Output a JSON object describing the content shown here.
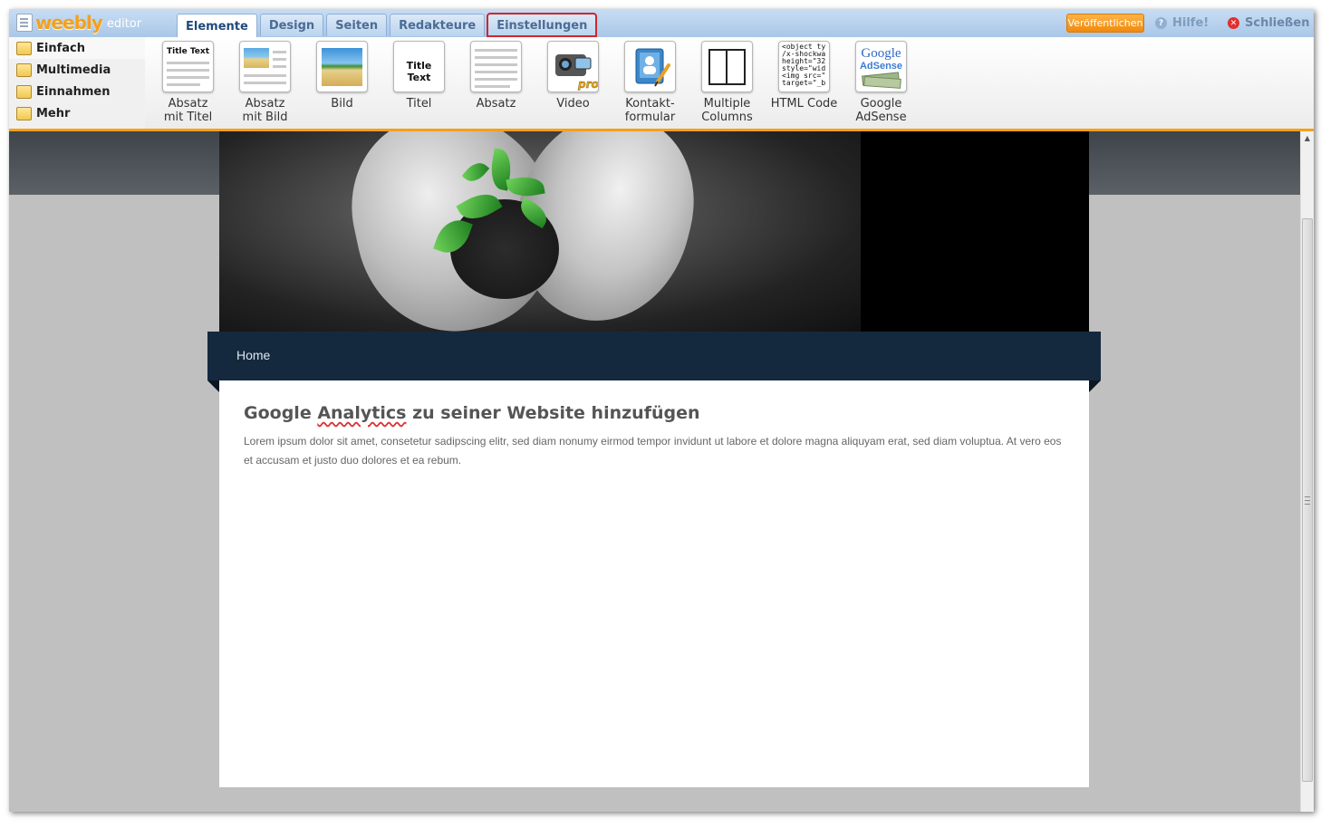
{
  "app": {
    "brand": "weebly",
    "subtitle": "editor"
  },
  "tabs": [
    {
      "label": "Elemente",
      "active": true
    },
    {
      "label": "Design"
    },
    {
      "label": "Seiten"
    },
    {
      "label": "Redakteure"
    },
    {
      "label": "Einstellungen",
      "highlighted": true
    }
  ],
  "actions": {
    "publish": "Veröffentlichen",
    "help": "Hilfe!",
    "close": "Schließen"
  },
  "categories": [
    {
      "label": "Einfach",
      "icon": "folder-icon"
    },
    {
      "label": "Multimedia",
      "icon": "film-icon"
    },
    {
      "label": "Einnahmen",
      "icon": "folder-icon"
    },
    {
      "label": "Mehr",
      "icon": "arrow-icon"
    }
  ],
  "elements": [
    {
      "label": "Absatz\nmit Titel",
      "thumb_title": "Title Text"
    },
    {
      "label": "Absatz\nmit Bild"
    },
    {
      "label": "Bild"
    },
    {
      "label": "Titel",
      "thumb_title": "Title Text"
    },
    {
      "label": "Absatz"
    },
    {
      "label": "Video",
      "thumb_badge": "pro"
    },
    {
      "label": "Kontakt-\nformular"
    },
    {
      "label": "Multiple\nColumns"
    },
    {
      "label": "HTML Code",
      "thumb_code": "<object ty\n/x-shockwa\nheight=\"32\nstyle=\"wid\n<img src=\"\ntarget=\"_b"
    },
    {
      "label": "Google\nAdSense",
      "thumb_brand": "Google",
      "thumb_sub": "AdSense"
    }
  ],
  "site": {
    "nav": [
      "Home"
    ],
    "title_parts": [
      "Google ",
      "Analytics",
      " zu seiner Website hinzufügen"
    ],
    "body": "Lorem ipsum dolor sit amet, consetetur sadipscing elitr, sed diam nonumy eirmod tempor invidunt ut labore et dolore magna aliquyam erat, sed diam voluptua. At vero eos et accusam et justo duo dolores et ea rebum."
  },
  "colors": {
    "accent": "#f5a01a",
    "nav": "#14293e",
    "highlight": "#d0262c"
  }
}
